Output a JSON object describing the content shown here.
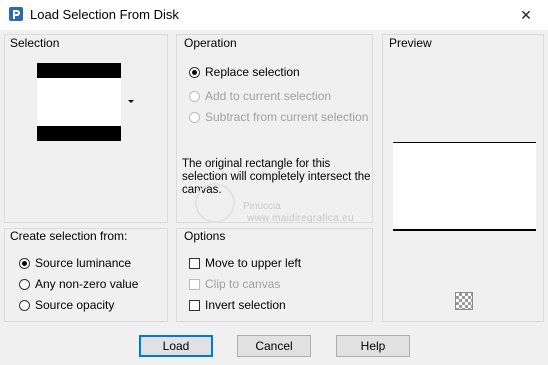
{
  "window": {
    "title": "Load Selection From Disk",
    "close_symbol": "✕"
  },
  "selection": {
    "title": "Selection"
  },
  "operation": {
    "title": "Operation",
    "options": [
      {
        "label": "Replace selection",
        "selected": true,
        "enabled": true
      },
      {
        "label": "Add to current selection",
        "selected": false,
        "enabled": false
      },
      {
        "label": "Subtract from current selection",
        "selected": false,
        "enabled": false
      }
    ],
    "description": "The original rectangle for this selection will completely intersect the canvas."
  },
  "preview": {
    "title": "Preview"
  },
  "create_from": {
    "title": "Create selection from:",
    "options": [
      {
        "label": "Source luminance",
        "selected": true
      },
      {
        "label": "Any non-zero value",
        "selected": false
      },
      {
        "label": "Source opacity",
        "selected": false
      }
    ]
  },
  "options": {
    "title": "Options",
    "items": [
      {
        "label": "Move to upper left",
        "checked": false,
        "enabled": true
      },
      {
        "label": "Clip to canvas",
        "checked": false,
        "enabled": false
      },
      {
        "label": "Invert selection",
        "checked": false,
        "enabled": true
      }
    ]
  },
  "buttons": {
    "load": "Load",
    "cancel": "Cancel",
    "help": "Help"
  },
  "watermark": {
    "name": "Pinuccia",
    "url": "www.maidiregrafica.eu"
  }
}
